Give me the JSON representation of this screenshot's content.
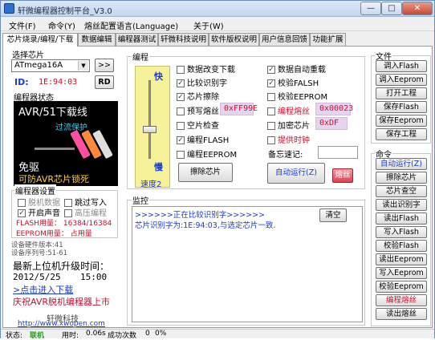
{
  "window": {
    "title": "轩微编程器控制平台_V3.0",
    "min": "—",
    "max": "□",
    "close": "✕"
  },
  "menu": [
    "文件(F)",
    "命令(Y)",
    "熔丝配置语言(Language)",
    "关于(W)"
  ],
  "tabs": [
    "芯片烧录/编程/下载",
    "数据编辑",
    "编程器测试",
    "轩微科技说明",
    "软件版权说明",
    "用户信息回馈",
    "功能扩展"
  ],
  "chip_select": {
    "label": "选择芯片",
    "selected": "ATmega16A",
    "next_button": ">>",
    "id_label": "ID:",
    "id_value": "1E:94:03",
    "rd_button": "RD"
  },
  "status_group": {
    "label": "编程器状态",
    "banner_lines": [
      "AVR/51下载线",
      "过流保护",
      "免驱",
      "可防AVR芯片锁死"
    ]
  },
  "settings": {
    "label": "编程器设置",
    "options": [
      {
        "label": "脱机数据",
        "checked": false,
        "enabled": false
      },
      {
        "label": "跳过写入",
        "checked": false,
        "enabled": true
      },
      {
        "label": "开启声音",
        "checked": true,
        "enabled": true
      },
      {
        "label": "高压编程",
        "checked": false,
        "enabled": false
      }
    ],
    "flash_usage": "FLASH用量：  16384/16384",
    "eeprom_usage": "EEPROM用量：      占用量"
  },
  "firmware": {
    "hw_version": "设备硬件版本:41",
    "sw_version": "设备序列号:51-61"
  },
  "upgrade": {
    "title": "最新上位机升级时间：",
    "date": "2012/5/25",
    "time": "15:00",
    "link": ">点击进入下载",
    "congrats": "庆祝AVR脱机编程器上市"
  },
  "company": {
    "name": "轩微科技",
    "url": "http://www.xwopen.com"
  },
  "program": {
    "label": "编程",
    "slider_fast": "快",
    "slider_slow": "慢",
    "speed_label": "速度2",
    "col1": [
      {
        "label": "数据改变下载",
        "checked": false
      },
      {
        "label": "比较识别字",
        "checked": true
      },
      {
        "label": "芯片擦除",
        "checked": true
      },
      {
        "label": "预写熔丝",
        "checked": false
      },
      {
        "label": "空片检查",
        "checked": false
      },
      {
        "label": "编程FLASH",
        "checked": true
      },
      {
        "label": "编程EEPROM",
        "checked": false
      }
    ],
    "col2": [
      {
        "label": "数据自动重载",
        "checked": true,
        "red": false
      },
      {
        "label": "校验FALSH",
        "checked": true,
        "red": false
      },
      {
        "label": "校验EEPROM",
        "checked": false,
        "red": false
      },
      {
        "label": "编程熔丝",
        "checked": false,
        "red": true
      },
      {
        "label": "加密芯片",
        "checked": false,
        "red": false
      },
      {
        "label": "提供时钟",
        "checked": false,
        "red": false
      }
    ],
    "prefuse_value": "0xFF99E",
    "fuse_value": "0x00023",
    "lock_value": "0xDF",
    "memo_label": "备忘速记:",
    "erase_button": "擦除芯片",
    "auto_button": "自动运行(Z)",
    "fuse_button": "熔丝"
  },
  "monitor": {
    "label": "监控",
    "lines": [
      ">>>>>>正在比较识别字>>>>>>",
      "芯片识别字为:1E:94:03,与选定芯片一致."
    ],
    "clear_button": "清空"
  },
  "file_group": {
    "label": "文件",
    "buttons": [
      "调入Flash",
      "调入Eeprom",
      "打开工程",
      "保存Flash",
      "保存Eeprom",
      "保存工程"
    ]
  },
  "cmd_group": {
    "label": "命令",
    "buttons": [
      "自动运行(Z)",
      "擦除芯片",
      "芯片查空",
      "读出识别字",
      "读出Flash",
      "写入Flash",
      "校验Flash",
      "读出Eeprom",
      "写入Eeprom",
      "校验Eeprom",
      "编程熔丝",
      "读出熔丝"
    ]
  },
  "statusbar": {
    "state_label": "状态:",
    "state_value": "联机",
    "time_label": "用时:",
    "time_value": "0.06s",
    "success_label": "成功次数",
    "success_value": "0",
    "percent": "0%"
  },
  "colors": {
    "red_text": "#c8102e",
    "blue_text": "#1a3bd1",
    "link": "#1a3bd1",
    "online": "#1f9e1f",
    "hexbox_bg": "#e6d4ef"
  }
}
